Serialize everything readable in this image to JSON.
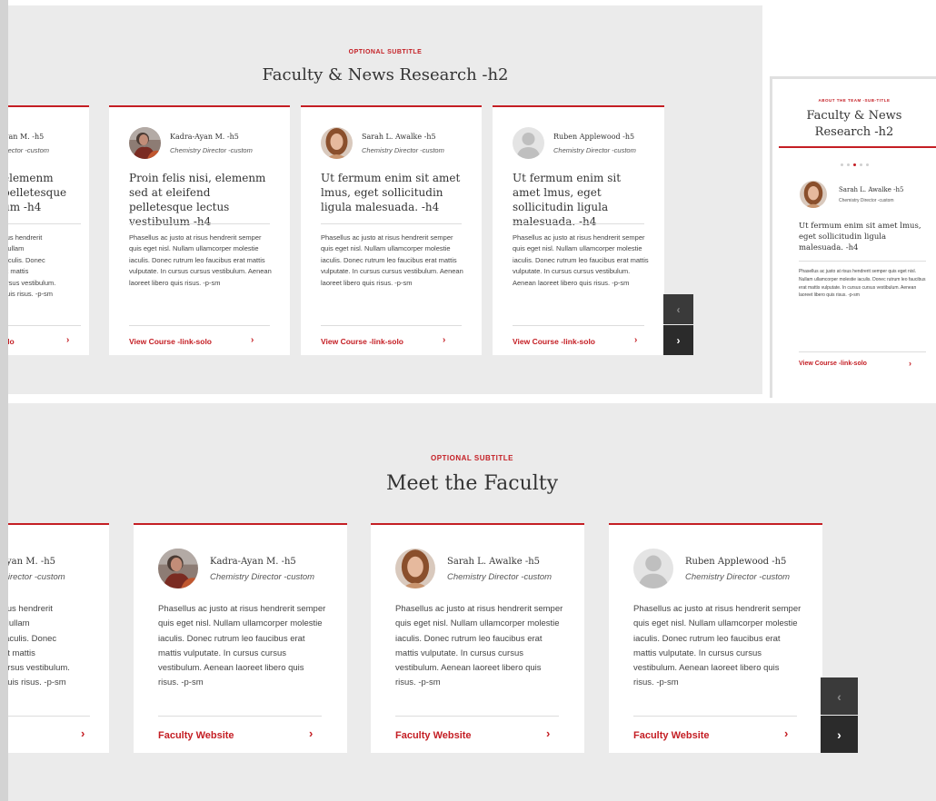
{
  "section1": {
    "subtitle": "OPTIONAL SUBTITLE",
    "heading": "Faculty & News Research -h2",
    "partial_card": {
      "name": "yan M. -h5",
      "role": "Director -custom",
      "title_lines": [
        "elemenm",
        "pelletesque",
        "um -h4"
      ],
      "body_lines": [
        "sus hendrerit",
        "Nullam",
        "iaculis. Donec",
        "at mattis",
        "ursus vestibulum.",
        "quis risus. -p-sm"
      ],
      "link": "olo"
    },
    "cards": [
      {
        "name": "Kadra-Ayan M. -h5",
        "role": "Chemistry Director -custom",
        "avatar": "photo",
        "title": "Proin felis nisi, elemenm sed at eleifend pelletesque lectus vestibulum -h4",
        "body": "Phasellus ac justo at risus hendrerit semper quis eget nisl. Nullam ullamcorper molestie iaculis. Donec rutrum leo faucibus erat mattis vulputate. In cursus cursus vestibulum. Aenean laoreet libero quis risus. -p-sm",
        "link": "View Course -link-solo"
      },
      {
        "name": "Sarah L. Awalke -h5",
        "role": "Chemistry Director -custom",
        "avatar": "photo",
        "title": "Ut fermum enim sit amet lmus, eget sollicitudin ligula malesuada. -h4",
        "body": "Phasellus ac justo at risus hendrerit semper quis eget nisl. Nullam ullamcorper molestie iaculis. Donec rutrum leo faucibus erat mattis vulputate. In cursus cursus vestibulum. Aenean laoreet libero quis risus. -p-sm",
        "link": "View Course -link-solo"
      },
      {
        "name": "Ruben Applewood -h5",
        "role": "Chemistry Director -custom",
        "avatar": "placeholder",
        "title": "Ut fermum enim sit amet lmus, eget sollicitudin ligula malesuada. -h4",
        "body": "Phasellus ac justo at risus hendrerit semper quis eget nisl. Nullam ullamcorper molestie iaculis. Donec rutrum leo faucibus erat mattis vulputate. In cursus cursus vestibulum. Aenean laoreet libero quis risus. -p-sm",
        "link": "View Course -link-solo"
      }
    ],
    "prev_icon": "chevron-left-icon",
    "next_icon": "chevron-right-icon"
  },
  "mobile": {
    "subtitle": "ABOUT THE TEAM -SUB-TITLE",
    "heading": "Faculty & News Research -h2",
    "card": {
      "name": "Sarah L. Awalke -h5",
      "role": "Chemistry Director -custom",
      "title": "Ut fermum enim sit amet lmus, eget sollicitudin ligula malesuada. -h4",
      "body": "Phasellus ac justo at risus hendrerit semper quis eget nisl. Nullam ullamcorper molestie iaculis. Donec rutrum leo faucibus erat mattis vulputate. In cursus cursus vestibulum. Aenean laoreet libero quis risus. -p-sm",
      "link": "View Course -link-solo"
    },
    "dots_total": 5,
    "dots_active": 2
  },
  "section2": {
    "subtitle": "OPTIONAL SUBTITLE",
    "heading": "Meet the Faculty",
    "partial_card": {
      "name": "yan M. -h5",
      "role": "Director -custom",
      "body_lines": [
        "sus hendrerit",
        "Nullam",
        "iaculis. Donec",
        "at mattis",
        "ursus vestibulum.",
        "quis risus. -p-sm"
      ]
    },
    "cards": [
      {
        "name": "Kadra-Ayan M. -h5",
        "role": "Chemistry Director -custom",
        "avatar": "photo",
        "body": "Phasellus ac justo at risus hendrerit semper quis eget nisl. Nullam ullamcorper molestie iaculis. Donec rutrum leo faucibus erat mattis vulputate. In cursus cursus vestibulum. Aenean laoreet libero quis risus. -p-sm",
        "link": "Faculty Website"
      },
      {
        "name": "Sarah L. Awalke -h5",
        "role": "Chemistry Director -custom",
        "avatar": "photo",
        "body": "Phasellus ac justo at risus hendrerit semper quis eget nisl. Nullam ullamcorper molestie iaculis. Donec rutrum leo faucibus erat mattis vulputate. In cursus cursus vestibulum. Aenean laoreet libero quis risus. -p-sm",
        "link": "Faculty Website"
      },
      {
        "name": "Ruben Applewood -h5",
        "role": "Chemistry Director -custom",
        "avatar": "placeholder",
        "body": "Phasellus ac justo at risus hendrerit semper quis eget nisl. Nullam ullamcorper molestie iaculis. Donec rutrum leo faucibus erat mattis vulputate. In cursus cursus vestibulum. Aenean laoreet libero quis risus. -p-sm",
        "link": "Faculty Website"
      }
    ],
    "prev_icon": "chevron-left-icon",
    "next_icon": "chevron-right-icon"
  },
  "colors": {
    "accent": "#c41e24",
    "panel": "#ebebeb",
    "nav_button": "#2b2b2b"
  }
}
